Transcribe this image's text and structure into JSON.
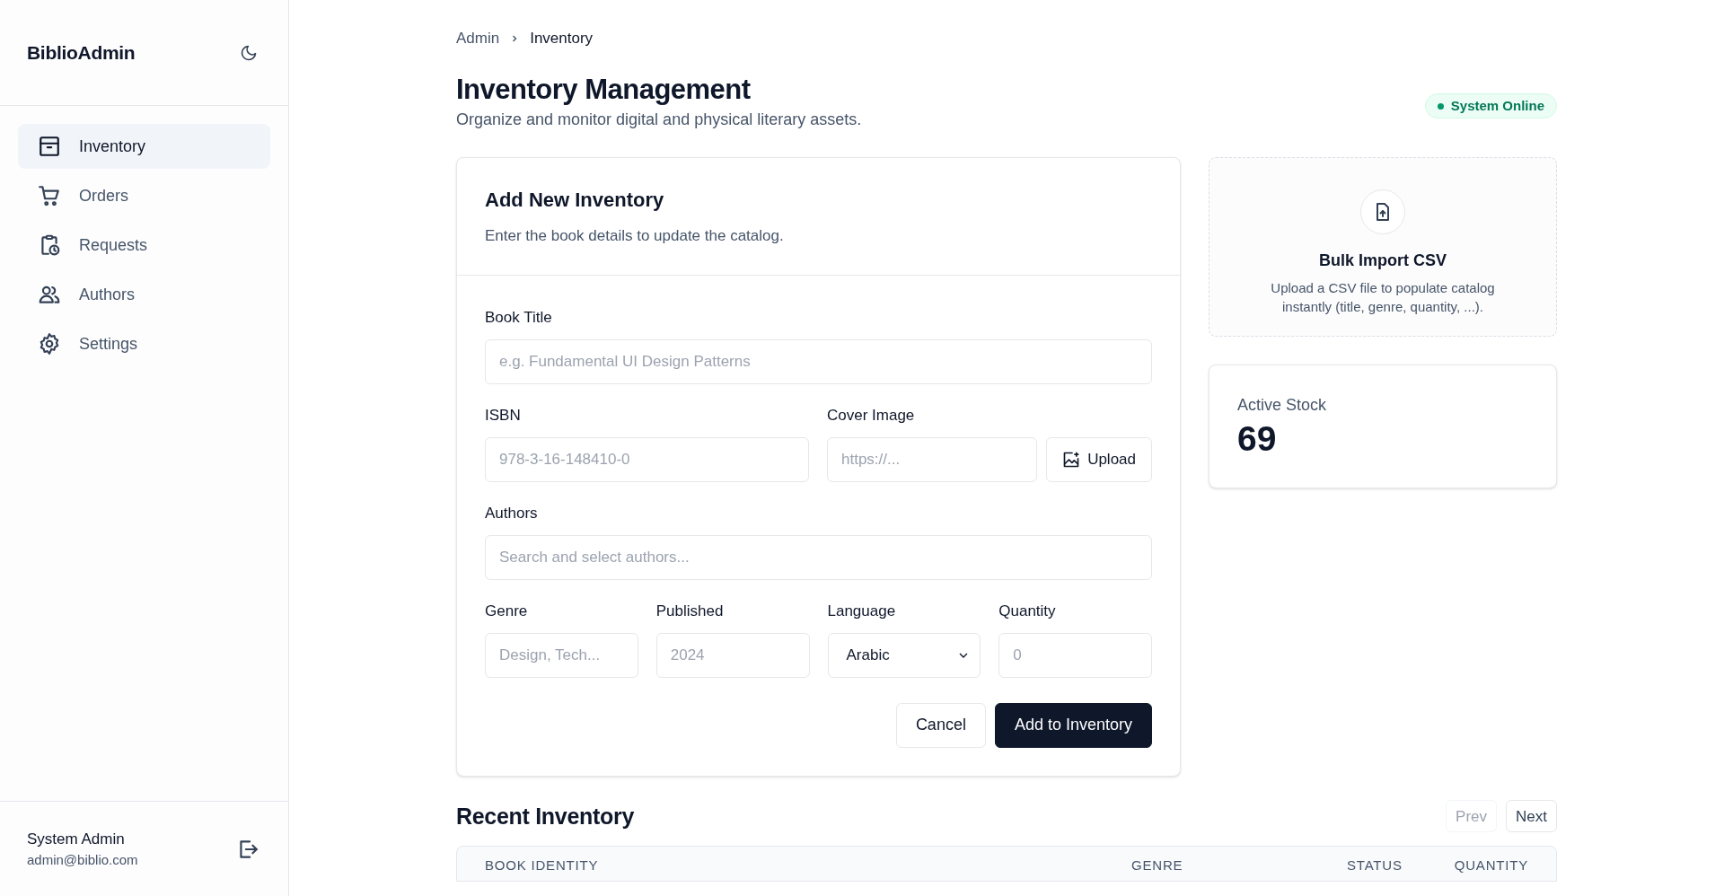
{
  "sidebar": {
    "brand": "BiblioAdmin",
    "items": [
      {
        "label": "Inventory",
        "selected": true
      },
      {
        "label": "Orders",
        "selected": false
      },
      {
        "label": "Requests",
        "selected": false
      },
      {
        "label": "Authors",
        "selected": false
      },
      {
        "label": "Settings",
        "selected": false
      }
    ],
    "user": {
      "name": "System Admin",
      "email": "admin@biblio.com"
    }
  },
  "breadcrumb": [
    "Admin",
    "Inventory"
  ],
  "page": {
    "title": "Inventory Management",
    "subtitle": "Organize and monitor digital and physical literary assets.",
    "status": "System Online"
  },
  "form": {
    "title": "Add New Inventory",
    "subtitle": "Enter the book details to update the catalog.",
    "book_title": {
      "label": "Book Title",
      "placeholder": "e.g. Fundamental UI Design Patterns"
    },
    "isbn": {
      "label": "ISBN",
      "placeholder": "978-3-16-148410-0"
    },
    "cover_image": {
      "label": "Cover Image",
      "placeholder": "https://...",
      "button": "Upload"
    },
    "authors": {
      "label": "Authors",
      "placeholder": "Search and select authors..."
    },
    "genre": {
      "label": "Genre",
      "placeholder": "Design, Tech..."
    },
    "published": {
      "label": "Published",
      "placeholder": "2024"
    },
    "language": {
      "label": "Language",
      "value": "Arabic"
    },
    "quantity": {
      "label": "Quantity",
      "placeholder": "0"
    },
    "buttons": [
      {
        "label": "Cancel",
        "kind": "secondary"
      },
      {
        "label": "Add to Inventory",
        "kind": "primary"
      }
    ]
  },
  "bulk_import": {
    "title": "Bulk Import CSV",
    "description": "Upload a CSV file to populate catalog instantly (title, genre, quantity, ...)."
  },
  "stat": {
    "label": "Active Stock",
    "value": "69"
  },
  "recent": {
    "title": "Recent Inventory",
    "pager": [
      {
        "label": "Prev",
        "disabled": true
      },
      {
        "label": "Next",
        "disabled": false
      }
    ],
    "columns": [
      "BOOK IDENTITY",
      "GENRE",
      "STATUS",
      "QUANTITY"
    ]
  }
}
